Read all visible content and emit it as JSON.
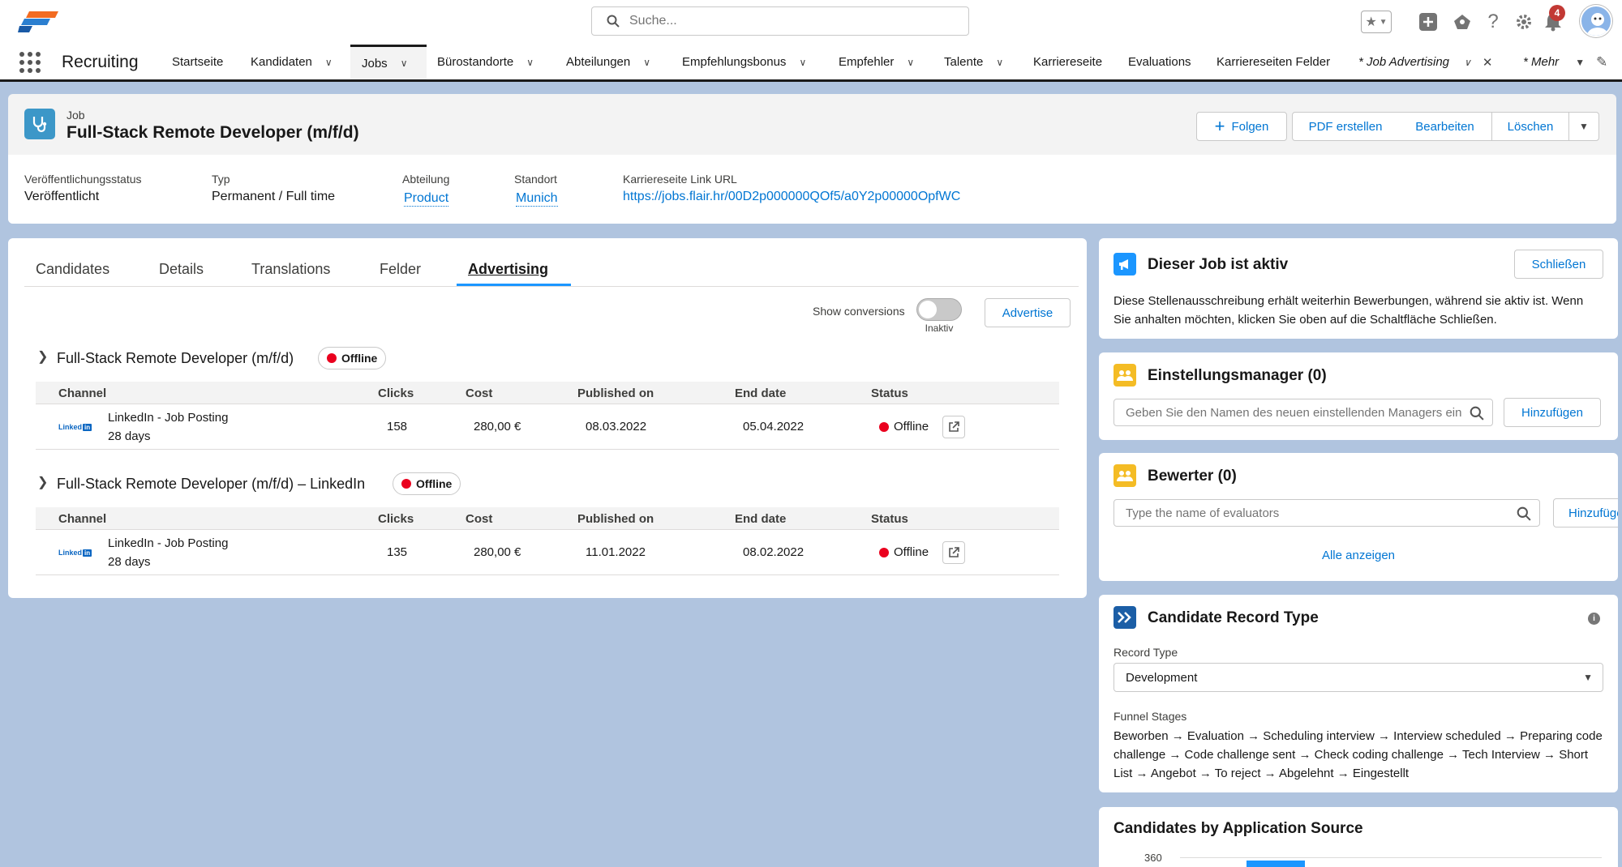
{
  "global_header": {
    "search_placeholder": "Suche...",
    "notification_count": "4",
    "icons": [
      "favorites-star-icon",
      "add-icon",
      "setup-assistant-icon",
      "help-icon",
      "settings-gear-icon",
      "notifications-bell-icon",
      "user-avatar"
    ]
  },
  "nav": {
    "app_name": "Recruiting",
    "items": [
      {
        "label": "Startseite",
        "has_chevron": false
      },
      {
        "label": "Kandidaten",
        "has_chevron": true
      },
      {
        "label": "Jobs",
        "has_chevron": true,
        "active": true
      },
      {
        "label": "Bürostandorte",
        "has_chevron": true
      },
      {
        "label": "Abteilungen",
        "has_chevron": true
      },
      {
        "label": "Empfehlungsbonus",
        "has_chevron": true
      },
      {
        "label": "Empfehler",
        "has_chevron": true
      },
      {
        "label": "Talente",
        "has_chevron": true
      },
      {
        "label": "Karriereseite",
        "has_chevron": false
      },
      {
        "label": "Evaluations",
        "has_chevron": false
      },
      {
        "label": "Karriereseiten Felder",
        "has_chevron": false
      },
      {
        "label": "* Job Advertising",
        "has_chevron": true,
        "closable": true
      },
      {
        "label": "* Mehr",
        "has_chevron": true
      }
    ]
  },
  "record": {
    "object_label": "Job",
    "title": "Full-Stack Remote Developer (m/f/d)",
    "actions": {
      "follow": "Folgen",
      "pdf": "PDF erstellen",
      "edit": "Bearbeiten",
      "delete": "Löschen"
    },
    "fields": [
      {
        "label": "Veröffentlichungsstatus",
        "value": "Veröffentlicht"
      },
      {
        "label": "Typ",
        "value": "Permanent / Full time"
      },
      {
        "label": "Abteilung",
        "value": "Product"
      },
      {
        "label": "Standort",
        "value": "Munich"
      },
      {
        "label": "Karriereseite Link URL",
        "value": "https://jobs.flair.hr/00D2p000000QOf5/a0Y2p00000OpfWC"
      }
    ]
  },
  "main": {
    "tabs": [
      "Candidates",
      "Details",
      "Translations",
      "Felder",
      "Advertising"
    ],
    "active_tab": "Advertising",
    "show_conversions_label": "Show conversions",
    "toggle_state_label": "Inaktiv",
    "advertise_button": "Advertise",
    "columns": [
      "Channel",
      "Clicks",
      "Cost",
      "Published on",
      "End date",
      "Status"
    ],
    "groups": [
      {
        "title": "Full-Stack Remote Developer (m/f/d)",
        "badge": "Offline",
        "rows": [
          {
            "logo": "Linked",
            "channel": "LinkedIn - Job Posting",
            "duration": "28 days",
            "clicks": "158",
            "cost": "280,00 €",
            "published": "08.03.2022",
            "end": "05.04.2022",
            "status": "Offline"
          }
        ]
      },
      {
        "title": "Full-Stack Remote Developer (m/f/d) – LinkedIn",
        "badge": "Offline",
        "rows": [
          {
            "logo": "Linked",
            "channel": "LinkedIn - Job Posting",
            "duration": "28 days",
            "clicks": "135",
            "cost": "280,00 €",
            "published": "11.01.2022",
            "end": "08.02.2022",
            "status": "Offline"
          }
        ]
      }
    ]
  },
  "sidebar": {
    "active_card": {
      "title": "Dieser Job ist aktiv",
      "button": "Schließen",
      "text": "Diese Stellenausschreibung erhält weiterhin Bewerbungen, während sie aktiv ist. Wenn Sie anhalten möchten, klicken Sie oben auf die Schaltfläche Schließen."
    },
    "hiring_manager": {
      "title": "Einstellungsmanager (0)",
      "placeholder": "Geben Sie den Namen des neuen einstellenden Managers ein",
      "button": "Hinzufügen"
    },
    "evaluators": {
      "title": "Bewerter (0)",
      "placeholder": "Type the name of evaluators",
      "button": "Hinzufügen",
      "view_all": "Alle anzeigen"
    },
    "record_type": {
      "title": "Candidate Record Type",
      "record_type_label": "Record Type",
      "record_type_value": "Development",
      "funnel_label": "Funnel Stages",
      "funnel_text": "Beworben → Evaluation → Scheduling interview → Interview scheduled → Preparing code challenge → Code challenge sent → Check coding challenge → Tech Interview → Short List → Angebot → To reject → Abgelehnt → Eingestellt"
    },
    "source_chart": {
      "title": "Candidates by Application Source",
      "axis_tick": "360"
    }
  },
  "colors": {
    "brand_blue": "#0176d3",
    "offline_red": "#ea001e",
    "background": "#b0c4df"
  }
}
